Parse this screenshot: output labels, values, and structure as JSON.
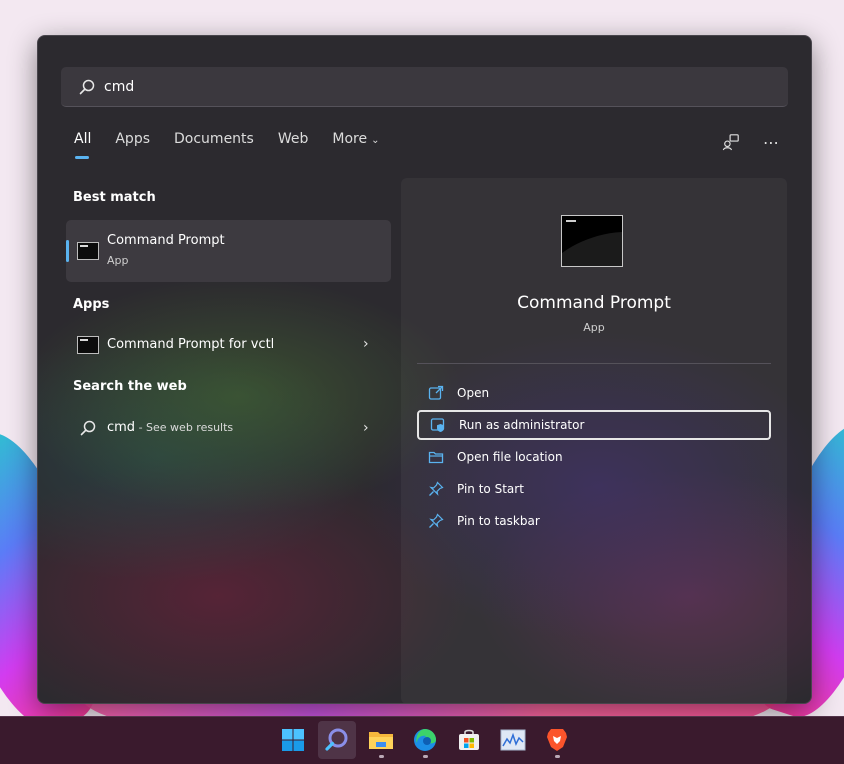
{
  "search": {
    "value": "cmd"
  },
  "tabs": [
    {
      "label": "All",
      "active": true
    },
    {
      "label": "Apps"
    },
    {
      "label": "Documents"
    },
    {
      "label": "Web"
    },
    {
      "label": "More"
    }
  ],
  "icons": {
    "search": "search-icon",
    "feedback": "feedback-icon",
    "more": "ellipsis-icon",
    "open": "open-icon",
    "admin": "shield-icon",
    "folder": "folder-icon",
    "pin": "pin-icon"
  },
  "sections": {
    "best_match": "Best match",
    "apps": "Apps",
    "web": "Search the web"
  },
  "best_match": {
    "name": "Command Prompt",
    "type": "App"
  },
  "apps": [
    {
      "name": "Command Prompt for vctl"
    }
  ],
  "web": {
    "query": "cmd",
    "suffix": " - See web results"
  },
  "detail": {
    "title": "Command Prompt",
    "subtitle": "App",
    "actions": [
      {
        "label": "Open"
      },
      {
        "label": "Run as administrator"
      },
      {
        "label": "Open file location"
      },
      {
        "label": "Pin to Start"
      },
      {
        "label": "Pin to taskbar"
      }
    ]
  },
  "colors": {
    "accent": "#5ab3f0",
    "panel": "#2c2a2f",
    "taskbar": "#3a1a2d"
  },
  "taskbar": {
    "items": [
      "windows-start-icon",
      "search-icon",
      "file-explorer-icon",
      "edge-icon",
      "store-icon",
      "resource-monitor-icon",
      "brave-icon"
    ]
  }
}
